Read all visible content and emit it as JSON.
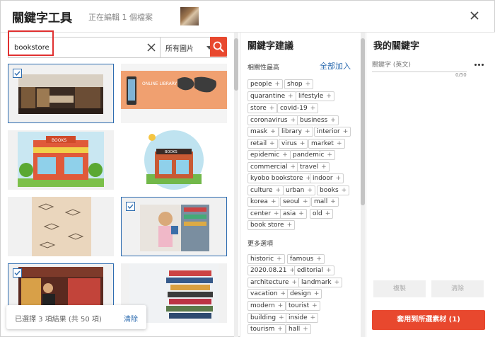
{
  "header": {
    "title": "關鍵字工具",
    "subtitle": "正在編輯 1 個檔案",
    "close_icon": "close-icon"
  },
  "search": {
    "value": "bookstore",
    "filter_label": "所有圖片",
    "icons": [
      "clear-icon",
      "chevron-down-icon",
      "search-icon"
    ]
  },
  "images": [
    {
      "id": "library-interior",
      "selected": true
    },
    {
      "id": "online-library-banner",
      "selected": false,
      "text": "ONLINE LIBRARY"
    },
    {
      "id": "books-shop-illustration",
      "selected": false,
      "text": "BOOKS"
    },
    {
      "id": "books-kiosk-illustration",
      "selected": false,
      "text": "BOOKS"
    },
    {
      "id": "book-pattern",
      "selected": false
    },
    {
      "id": "girl-reading",
      "selected": true
    },
    {
      "id": "bookstore-shopper",
      "selected": true
    },
    {
      "id": "book-stack",
      "selected": false
    }
  ],
  "status": {
    "text": "已選擇 3 項結果 (共 50 項)",
    "clear_label": "清除"
  },
  "suggestions": {
    "title": "關鍵字建議",
    "relevance_label": "相關性最高",
    "add_all_label": "全部加入",
    "top_tags": [
      "people",
      "shop",
      "quarantine",
      "lifestyle",
      "store",
      "covid-19",
      "coronavirus",
      "business",
      "mask",
      "library",
      "interior",
      "retail",
      "virus",
      "market",
      "epidemic",
      "pandemic",
      "commercial",
      "travel",
      "kyobo bookstore",
      "indoor",
      "culture",
      "urban",
      "books",
      "korea",
      "seoul",
      "mall",
      "center",
      "asia",
      "old",
      "book store"
    ],
    "more_label": "更多選項",
    "more_tags": [
      "historic",
      "famous",
      "2020.08.21",
      "editorial",
      "architecture",
      "landmark",
      "vacation",
      "design",
      "modern",
      "tourist",
      "building",
      "inside",
      "tourism",
      "hall"
    ]
  },
  "my_keywords": {
    "title": "我的關鍵字",
    "placeholder": "關鍵字 (英文)",
    "count": "0/50",
    "copy_label": "複製",
    "clear_label": "清除",
    "apply_label": "套用到所選素材 (1)"
  },
  "colors": {
    "accent": "#e8482e",
    "link": "#2d6cb0"
  }
}
